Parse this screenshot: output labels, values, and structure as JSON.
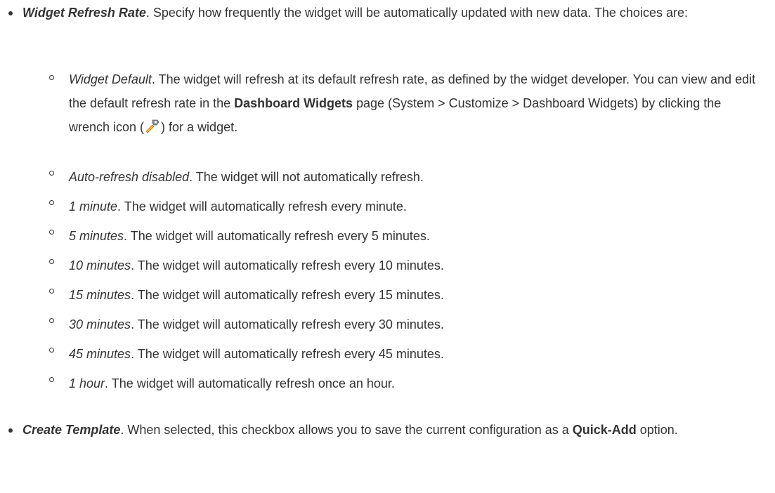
{
  "items": [
    {
      "term": "Widget Refresh Rate",
      "text": ". Specify how frequently the widget will be automatically updated with new data. The choices are:"
    },
    {
      "term": "Create Template",
      "text_before": ". When selected, this checkbox allows you to save the current configuration as a ",
      "bold": "Quick-Add",
      "text_after": " option."
    }
  ],
  "sub_items": [
    {
      "term": "Widget Default",
      "line1": ". The widget will refresh at its default refresh rate, as defined by the widget developer. You can view and edit the default refresh rate in the ",
      "bold": "Dashboard Widgets",
      "line2": " page (System > Customize > Dashboard Widgets) by clicking the wrench icon (",
      "line3": ") for a widget."
    },
    {
      "term": "Auto-refresh disabled",
      "text": ". The widget will not automatically refresh."
    },
    {
      "term": "1 minute",
      "text": ". The widget will automatically refresh every minute."
    },
    {
      "term": "5 minutes",
      "text": ". The widget will automatically refresh every 5 minutes."
    },
    {
      "term": "10 minutes",
      "text": ". The widget will automatically refresh every 10 minutes."
    },
    {
      "term": "15 minutes",
      "text": ". The widget will automatically refresh every 15 minutes."
    },
    {
      "term": "30 minutes",
      "text": ". The widget will automatically refresh every 30 minutes."
    },
    {
      "term": "45 minutes",
      "text": ". The widget will automatically refresh every 45 minutes."
    },
    {
      "term": "1 hour",
      "text": ". The widget will automatically refresh once an hour."
    }
  ],
  "icons": {
    "wrench": "wrench-icon"
  }
}
